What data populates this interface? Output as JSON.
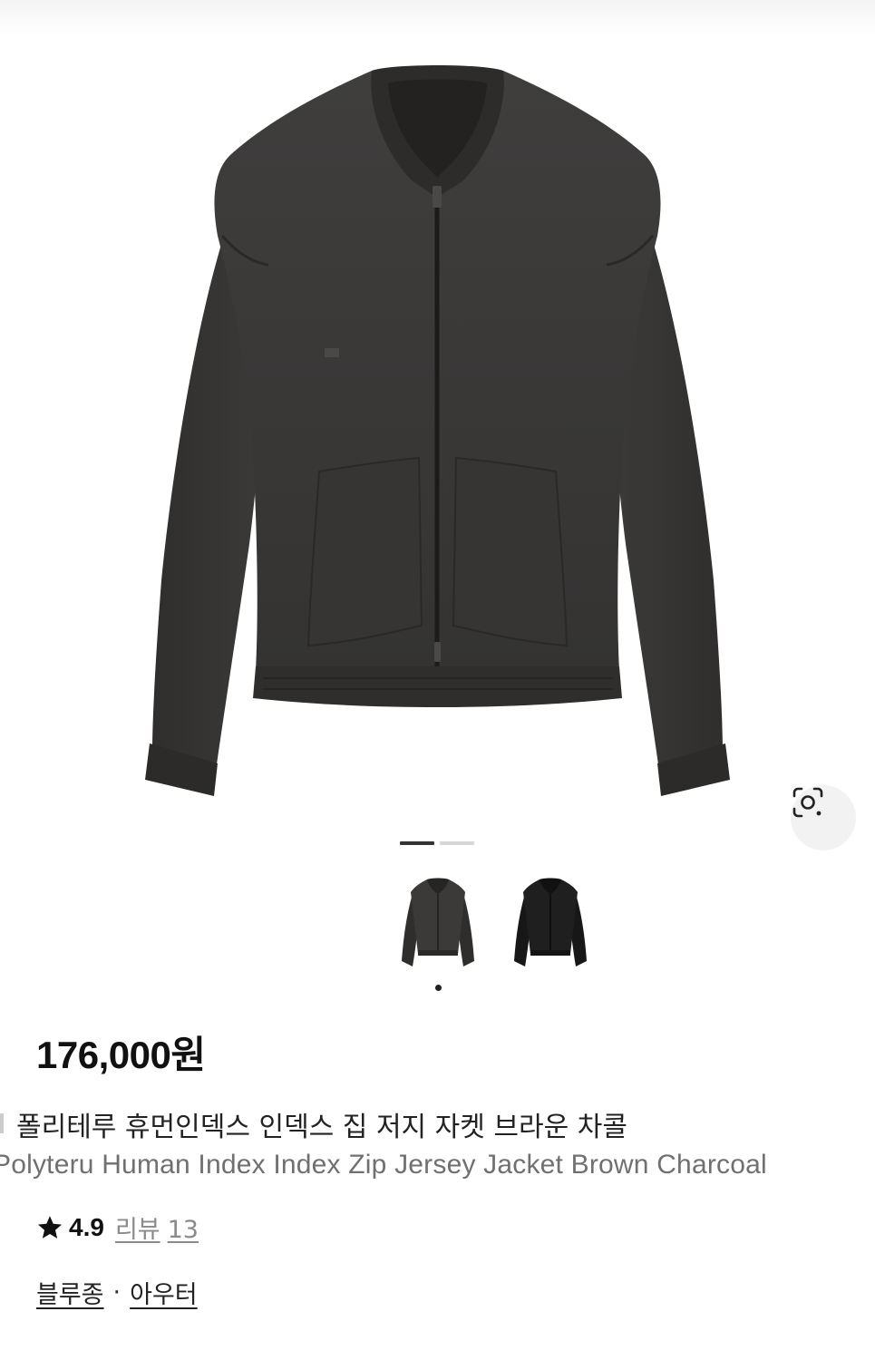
{
  "gallery": {
    "pages": 2,
    "active_page": 1,
    "thumbnails": [
      {
        "name": "brown-charcoal-jacket-thumbnail",
        "color": "#3a3837",
        "selected": true
      },
      {
        "name": "black-jacket-thumbnail",
        "color": "#1e1e1e",
        "selected": false
      }
    ],
    "lens_icon": "image-search-lens-icon"
  },
  "product": {
    "price": "176,000원",
    "title_ko": "폴리테루 휴먼인덱스 인덱스 집 저지 자켓 브라운 차콜",
    "title_en": "Polyteru Human Index Index Zip Jersey Jacket Brown Charcoal",
    "rating": {
      "icon": "star-icon",
      "score": "4.9",
      "review_label": "리뷰",
      "review_count": "13"
    },
    "categories": [
      "블루종",
      "아우터"
    ],
    "category_separator": "·"
  },
  "colors": {
    "jacket_main": "#3b3a39",
    "jacket_dark": "#2b2a29",
    "pager_active": "#333333",
    "pager_inactive": "#d6d6d6"
  }
}
